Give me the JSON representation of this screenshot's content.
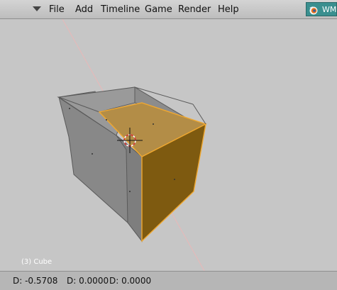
{
  "menubar": {
    "items": [
      {
        "label": "File"
      },
      {
        "label": "Add"
      },
      {
        "label": "Timeline"
      },
      {
        "label": "Game"
      },
      {
        "label": "Render"
      },
      {
        "label": "Help"
      }
    ],
    "logo_text": "WM",
    "logo_icon": "blender-logo-icon"
  },
  "viewport": {
    "object_label": "(3) Cube",
    "selected_face_color": "#b08a42",
    "selected_edge_color": "#f0a830",
    "mesh_color": "#868686",
    "background_color": "#c6c6c6"
  },
  "status": {
    "d1": "D: -0.5708",
    "d2": "D: 0.0000",
    "d3": "D: 0.0000"
  }
}
